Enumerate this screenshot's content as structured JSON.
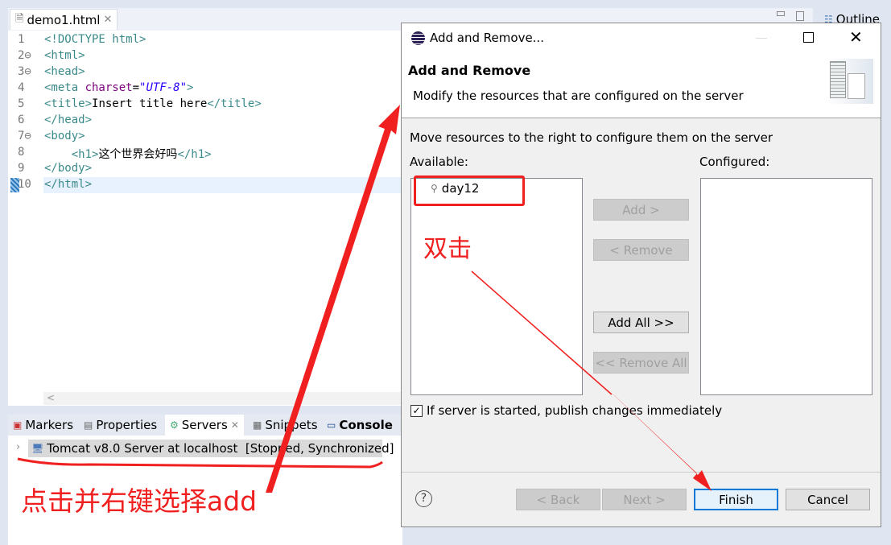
{
  "editor": {
    "tab": "demo1.html",
    "lines": [
      {
        "n": "1",
        "html": "<span class='tg'>&lt;!DOCTYPE html&gt;</span>"
      },
      {
        "n": "2⊖",
        "html": "<span class='tg'>&lt;html&gt;</span>"
      },
      {
        "n": "3⊖",
        "html": "<span class='tg'>&lt;head&gt;</span>"
      },
      {
        "n": "4",
        "html": "<span class='tg'>&lt;meta </span><span class='at'>charset</span>=<span class='st'>\"UTF-8\"</span><span class='tg'>&gt;</span>"
      },
      {
        "n": "5",
        "html": "<span class='tg'>&lt;title&gt;</span>Insert title here<span class='tg'>&lt;/title&gt;</span>"
      },
      {
        "n": "6",
        "html": "<span class='tg'>&lt;/head&gt;</span>"
      },
      {
        "n": "7⊖",
        "html": "<span class='tg'>&lt;body&gt;</span>"
      },
      {
        "n": "8",
        "html": "    <span class='tg'>&lt;h1&gt;</span>这个世界会好吗<span class='tg'>&lt;/h1&gt;</span>"
      },
      {
        "n": "9",
        "html": "<span class='tg'>&lt;/body&gt;</span>"
      },
      {
        "n": "10",
        "html": "<span class='tg'>&lt;/html&gt;</span>"
      }
    ]
  },
  "outline_tab": "Outline",
  "bottom_tabs": {
    "markers": "Markers",
    "properties": "Properties",
    "servers": "Servers",
    "snippets": "Snippets",
    "console": "Console"
  },
  "server_row": "Tomcat v8.0 Server at localhost  [Stopped, Synchronized]",
  "dialog": {
    "title": "Add and Remove...",
    "header": "Add and Remove",
    "subtitle": "Modify the resources that are configured on the server",
    "instruction": "Move resources to the right to configure them on the server",
    "available_label": "Available:",
    "configured_label": "Configured:",
    "available_items": [
      "day12"
    ],
    "add": "Add >",
    "remove": "< Remove",
    "add_all": "Add All >>",
    "remove_all": "<< Remove All",
    "checkbox": "If server is started, publish changes immediately",
    "checkbox_checked": true,
    "back": "< Back",
    "next": "Next >",
    "finish": "Finish",
    "cancel": "Cancel"
  },
  "annotations": {
    "double_click": "双击",
    "click_right": "点击并右键选择add",
    "color": "#f02020"
  }
}
